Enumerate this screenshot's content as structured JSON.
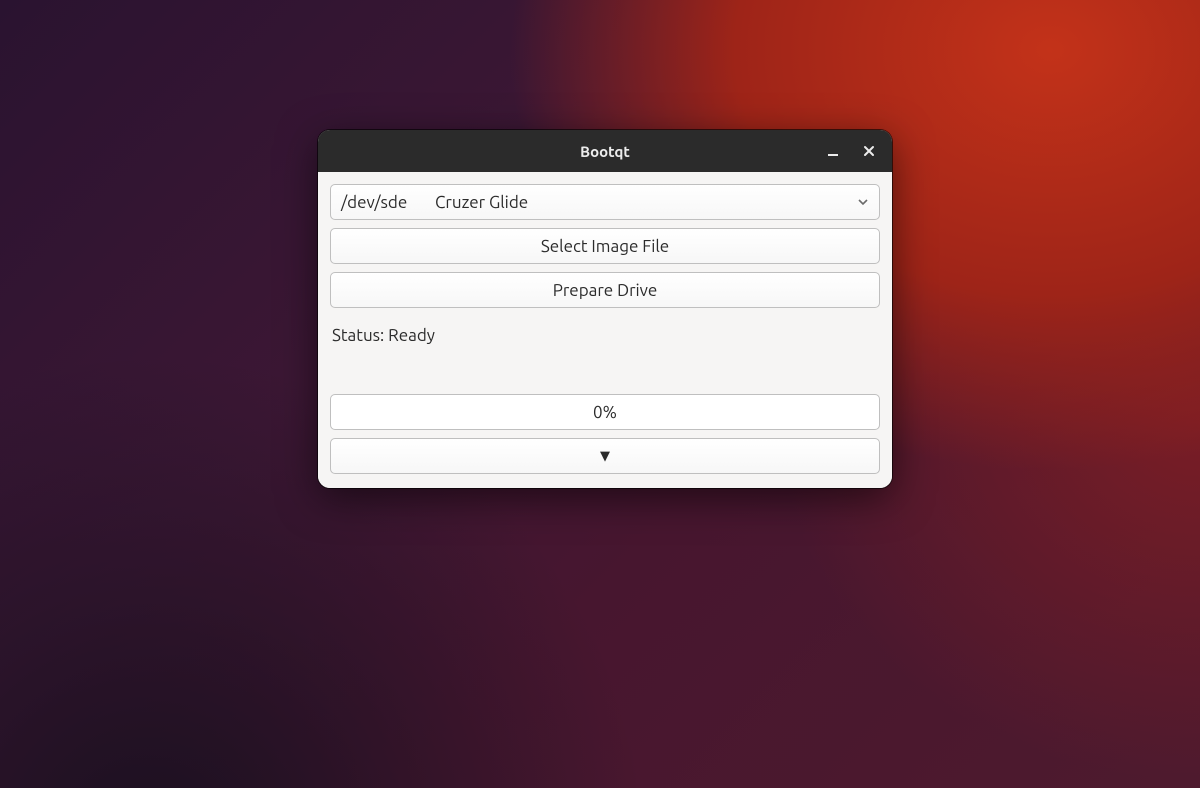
{
  "window": {
    "title": "Bootqt"
  },
  "drive_select": {
    "device": "/dev/sde",
    "label": "Cruzer Glide"
  },
  "buttons": {
    "select_image": "Select Image File",
    "prepare_drive": "Prepare Drive"
  },
  "status": {
    "text": "Status: Ready"
  },
  "progress": {
    "text": "0%"
  },
  "expander": {
    "glyph": "▼"
  }
}
